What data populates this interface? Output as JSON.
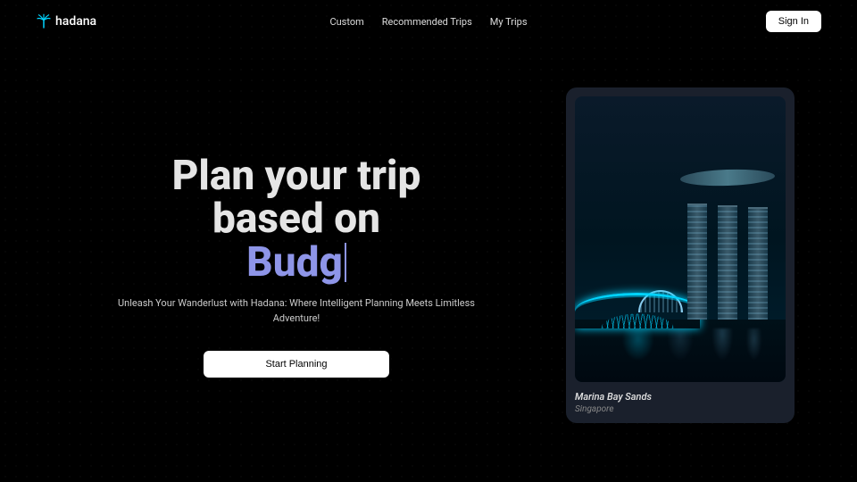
{
  "logo": {
    "text": "hadana"
  },
  "nav": {
    "links": [
      "Custom",
      "Recommended Trips",
      "My Trips"
    ],
    "signIn": "Sign In"
  },
  "hero": {
    "titleLine1": "Plan your trip",
    "titleLine2": "based on",
    "dynamicWord": "Budg",
    "subtitle": "Unleash Your Wanderlust with Hadana: Where Intelligent Planning Meets Limitless Adventure!",
    "ctaLabel": "Start Planning"
  },
  "card": {
    "title": "Marina Bay Sands",
    "location": "Singapore"
  }
}
